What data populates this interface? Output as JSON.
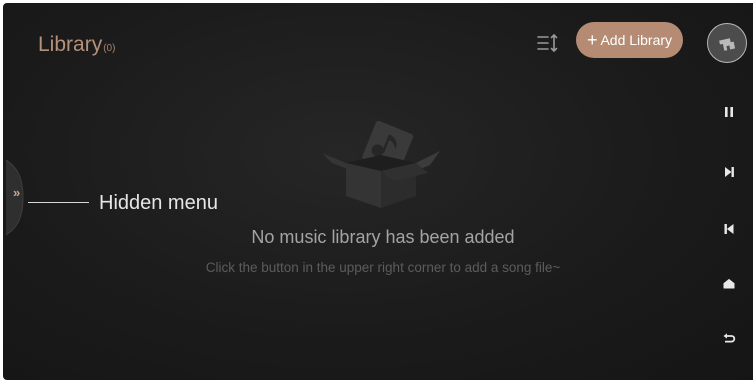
{
  "header": {
    "title": "Library",
    "count": "(0)",
    "add_button_label": "Add Library",
    "add_button_icon": "plus-icon",
    "sort_icon": "sort-list-icon"
  },
  "empty_state": {
    "illustration": "empty-box-music-icon",
    "title": "No music library has been added",
    "subtitle": "Click the button in the upper right corner to add a song file~"
  },
  "side_handle": {
    "icon": "double-chevron-right-icon",
    "annotation": "Hidden menu"
  },
  "right_controls": [
    "pause-icon",
    "next-track-icon",
    "previous-track-icon",
    "home-icon",
    "back-icon"
  ],
  "colors": {
    "accent": "#b58b73",
    "title": "#b5917a",
    "background": "#1b1b1b"
  }
}
